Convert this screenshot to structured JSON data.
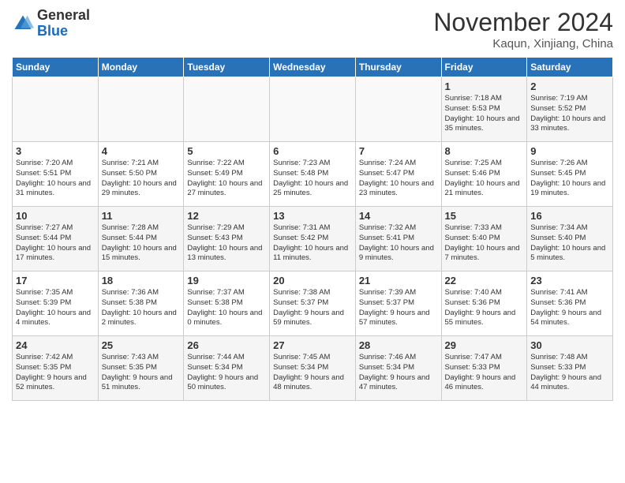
{
  "logo": {
    "general": "General",
    "blue": "Blue"
  },
  "header": {
    "month": "November 2024",
    "location": "Kaqun, Xinjiang, China"
  },
  "days_of_week": [
    "Sunday",
    "Monday",
    "Tuesday",
    "Wednesday",
    "Thursday",
    "Friday",
    "Saturday"
  ],
  "weeks": [
    [
      {
        "day": "",
        "info": ""
      },
      {
        "day": "",
        "info": ""
      },
      {
        "day": "",
        "info": ""
      },
      {
        "day": "",
        "info": ""
      },
      {
        "day": "",
        "info": ""
      },
      {
        "day": "1",
        "info": "Sunrise: 7:18 AM\nSunset: 5:53 PM\nDaylight: 10 hours and 35 minutes."
      },
      {
        "day": "2",
        "info": "Sunrise: 7:19 AM\nSunset: 5:52 PM\nDaylight: 10 hours and 33 minutes."
      }
    ],
    [
      {
        "day": "3",
        "info": "Sunrise: 7:20 AM\nSunset: 5:51 PM\nDaylight: 10 hours and 31 minutes."
      },
      {
        "day": "4",
        "info": "Sunrise: 7:21 AM\nSunset: 5:50 PM\nDaylight: 10 hours and 29 minutes."
      },
      {
        "day": "5",
        "info": "Sunrise: 7:22 AM\nSunset: 5:49 PM\nDaylight: 10 hours and 27 minutes."
      },
      {
        "day": "6",
        "info": "Sunrise: 7:23 AM\nSunset: 5:48 PM\nDaylight: 10 hours and 25 minutes."
      },
      {
        "day": "7",
        "info": "Sunrise: 7:24 AM\nSunset: 5:47 PM\nDaylight: 10 hours and 23 minutes."
      },
      {
        "day": "8",
        "info": "Sunrise: 7:25 AM\nSunset: 5:46 PM\nDaylight: 10 hours and 21 minutes."
      },
      {
        "day": "9",
        "info": "Sunrise: 7:26 AM\nSunset: 5:45 PM\nDaylight: 10 hours and 19 minutes."
      }
    ],
    [
      {
        "day": "10",
        "info": "Sunrise: 7:27 AM\nSunset: 5:44 PM\nDaylight: 10 hours and 17 minutes."
      },
      {
        "day": "11",
        "info": "Sunrise: 7:28 AM\nSunset: 5:44 PM\nDaylight: 10 hours and 15 minutes."
      },
      {
        "day": "12",
        "info": "Sunrise: 7:29 AM\nSunset: 5:43 PM\nDaylight: 10 hours and 13 minutes."
      },
      {
        "day": "13",
        "info": "Sunrise: 7:31 AM\nSunset: 5:42 PM\nDaylight: 10 hours and 11 minutes."
      },
      {
        "day": "14",
        "info": "Sunrise: 7:32 AM\nSunset: 5:41 PM\nDaylight: 10 hours and 9 minutes."
      },
      {
        "day": "15",
        "info": "Sunrise: 7:33 AM\nSunset: 5:40 PM\nDaylight: 10 hours and 7 minutes."
      },
      {
        "day": "16",
        "info": "Sunrise: 7:34 AM\nSunset: 5:40 PM\nDaylight: 10 hours and 5 minutes."
      }
    ],
    [
      {
        "day": "17",
        "info": "Sunrise: 7:35 AM\nSunset: 5:39 PM\nDaylight: 10 hours and 4 minutes."
      },
      {
        "day": "18",
        "info": "Sunrise: 7:36 AM\nSunset: 5:38 PM\nDaylight: 10 hours and 2 minutes."
      },
      {
        "day": "19",
        "info": "Sunrise: 7:37 AM\nSunset: 5:38 PM\nDaylight: 10 hours and 0 minutes."
      },
      {
        "day": "20",
        "info": "Sunrise: 7:38 AM\nSunset: 5:37 PM\nDaylight: 9 hours and 59 minutes."
      },
      {
        "day": "21",
        "info": "Sunrise: 7:39 AM\nSunset: 5:37 PM\nDaylight: 9 hours and 57 minutes."
      },
      {
        "day": "22",
        "info": "Sunrise: 7:40 AM\nSunset: 5:36 PM\nDaylight: 9 hours and 55 minutes."
      },
      {
        "day": "23",
        "info": "Sunrise: 7:41 AM\nSunset: 5:36 PM\nDaylight: 9 hours and 54 minutes."
      }
    ],
    [
      {
        "day": "24",
        "info": "Sunrise: 7:42 AM\nSunset: 5:35 PM\nDaylight: 9 hours and 52 minutes."
      },
      {
        "day": "25",
        "info": "Sunrise: 7:43 AM\nSunset: 5:35 PM\nDaylight: 9 hours and 51 minutes."
      },
      {
        "day": "26",
        "info": "Sunrise: 7:44 AM\nSunset: 5:34 PM\nDaylight: 9 hours and 50 minutes."
      },
      {
        "day": "27",
        "info": "Sunrise: 7:45 AM\nSunset: 5:34 PM\nDaylight: 9 hours and 48 minutes."
      },
      {
        "day": "28",
        "info": "Sunrise: 7:46 AM\nSunset: 5:34 PM\nDaylight: 9 hours and 47 minutes."
      },
      {
        "day": "29",
        "info": "Sunrise: 7:47 AM\nSunset: 5:33 PM\nDaylight: 9 hours and 46 minutes."
      },
      {
        "day": "30",
        "info": "Sunrise: 7:48 AM\nSunset: 5:33 PM\nDaylight: 9 hours and 44 minutes."
      }
    ]
  ]
}
